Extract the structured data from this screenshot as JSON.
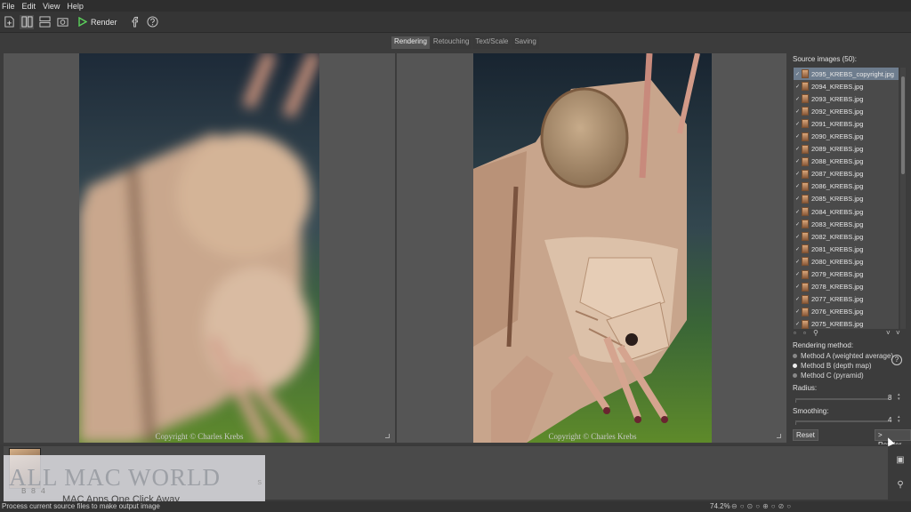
{
  "menu": [
    "File",
    "Edit",
    "View",
    "Help"
  ],
  "toolbar": {
    "render_label": "Render",
    "icons": [
      "new-file-icon",
      "side-by-side-icon",
      "stacked-view-icon",
      "screenshot-icon",
      "render-play-icon",
      "facebook-icon",
      "help-icon"
    ]
  },
  "tabs": [
    {
      "label": "Rendering",
      "active": true
    },
    {
      "label": "Retouching",
      "active": false
    },
    {
      "label": "Text/Scale",
      "active": false
    },
    {
      "label": "Saving",
      "active": false
    }
  ],
  "viewers": {
    "left_copyright": "Copyright © Charles Krebs",
    "right_copyright": "Copyright © Charles Krebs"
  },
  "sidebar": {
    "source_title": "Source images (50):",
    "files": [
      "2095_KREBS_copyright.jpg",
      "2094_KREBS.jpg",
      "2093_KREBS.jpg",
      "2092_KREBS.jpg",
      "2091_KREBS.jpg",
      "2090_KREBS.jpg",
      "2089_KREBS.jpg",
      "2088_KREBS.jpg",
      "2087_KREBS.jpg",
      "2086_KREBS.jpg",
      "2085_KREBS.jpg",
      "2084_KREBS.jpg",
      "2083_KREBS.jpg",
      "2082_KREBS.jpg",
      "2081_KREBS.jpg",
      "2080_KREBS.jpg",
      "2079_KREBS.jpg",
      "2078_KREBS.jpg",
      "2077_KREBS.jpg",
      "2076_KREBS.jpg",
      "2075_KREBS.jpg"
    ],
    "rendering_method_label": "Rendering method:",
    "methods": [
      {
        "label": "Method A (weighted average)",
        "selected": false
      },
      {
        "label": "Method B (depth map)",
        "selected": true
      },
      {
        "label": "Method C (pyramid)",
        "selected": false
      }
    ],
    "radius_label": "Radius:",
    "radius_value": "8",
    "smoothing_label": "Smoothing:",
    "smoothing_value": "4",
    "reset_label": "Reset",
    "render_label": "> Render"
  },
  "watermark": {
    "logo": "ALL MAC WORLD",
    "suffix": "S",
    "tagline": "MAC Apps One Click Away",
    "frame_number": "B 8 4"
  },
  "status": {
    "text": "Process current source files to make output image",
    "zoom": "74.2%"
  }
}
